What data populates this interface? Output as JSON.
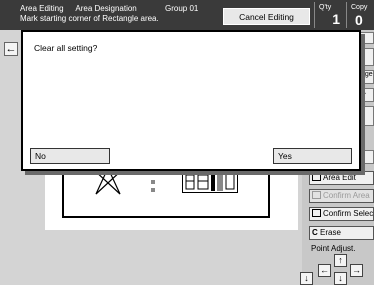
{
  "topbar": {
    "area_editing": "Area Editing",
    "area_designation": "Area Designation",
    "group": "Group 01",
    "instruction": "Mark starting corner of Rectangle area.",
    "cancel_editing": "Cancel Editing",
    "qty_label": "Q'ty",
    "qty_value": "1",
    "copy_label": "Copy",
    "copy_value": "0"
  },
  "back_icon": "←",
  "right_panel": {
    "area_edit": "Area Edit",
    "confirm_area": "Confirm Area",
    "confirm_select": "Confirm Select",
    "erase": "Erase",
    "erase_glyph": "C",
    "point_adjust": "Point Adjust.",
    "stub_age": "age",
    "stub_a": "A",
    "stub_ag": "ag"
  },
  "dialog": {
    "message": "Clear all setting?",
    "no": "No",
    "yes": "Yes"
  },
  "arrows": {
    "up": "↑",
    "down": "↓",
    "left": "←",
    "right": "→"
  }
}
